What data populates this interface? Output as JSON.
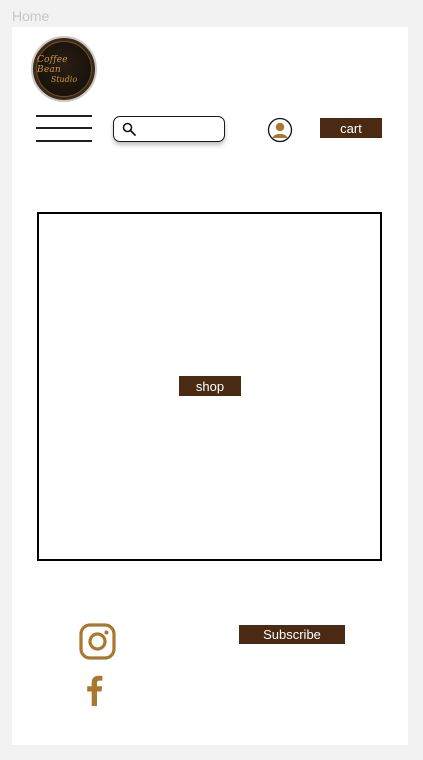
{
  "frame": {
    "label": "Home"
  },
  "brand": {
    "logo_line1": "Coffee Bean",
    "logo_line2": "Studio"
  },
  "header": {
    "menu_icon": "hamburger-icon",
    "search": {
      "icon": "search-icon",
      "value": "",
      "placeholder": ""
    },
    "account_icon": "user-icon",
    "cart_label": "cart"
  },
  "hero": {
    "shop_label": "shop"
  },
  "footer": {
    "social": [
      {
        "icon": "instagram-icon"
      },
      {
        "icon": "facebook-icon"
      }
    ],
    "subscribe_label": "Subscribe"
  },
  "colors": {
    "brand_brown": "#4a2a12",
    "accent_gold": "#a9772e",
    "canvas": "#f2f2f2",
    "frame": "#ffffff"
  }
}
